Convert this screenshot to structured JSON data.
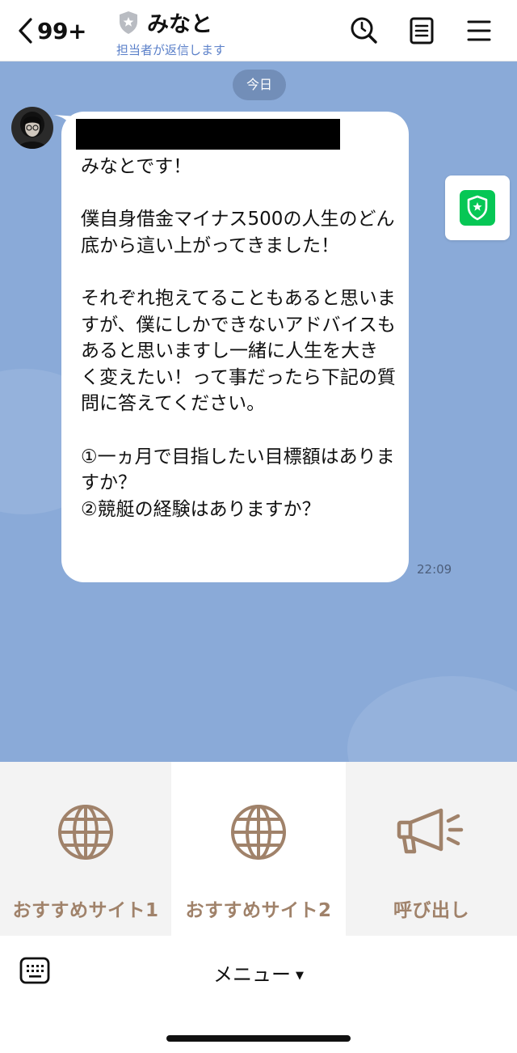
{
  "header": {
    "back_count": "99+",
    "name": "みなと",
    "subtitle": "担当者が返信します"
  },
  "chat": {
    "date_label": "今日",
    "message": {
      "text": "みなとです！\n\n僕自身借金マイナス500の人生のどん底から這い上がってきました！\n\nそれぞれ抱えてることもあると思いますが、僕にしかできないアドバイスもあると思いますし一緒に人生を大きく変えたい！って事だったら下記の質問に答えてください。\n\n①一ヵ月で目指したい目標額はありますか？\n②競艇の経験はありますか？",
      "time": "22:09"
    }
  },
  "rich_menu": {
    "items": [
      {
        "label": "おすすめサイト1",
        "icon": "globe-icon"
      },
      {
        "label": "おすすめサイト2",
        "icon": "globe-icon"
      },
      {
        "label": "呼び出し",
        "icon": "megaphone-icon"
      }
    ]
  },
  "bottom_bar": {
    "menu_label": "メニュー",
    "caret": "▼"
  },
  "colors": {
    "chat_background": "#8aaad8",
    "subtitle": "#5b80c9",
    "rich_menu_icon": "#a0826a",
    "safety_green": "#06c755"
  }
}
